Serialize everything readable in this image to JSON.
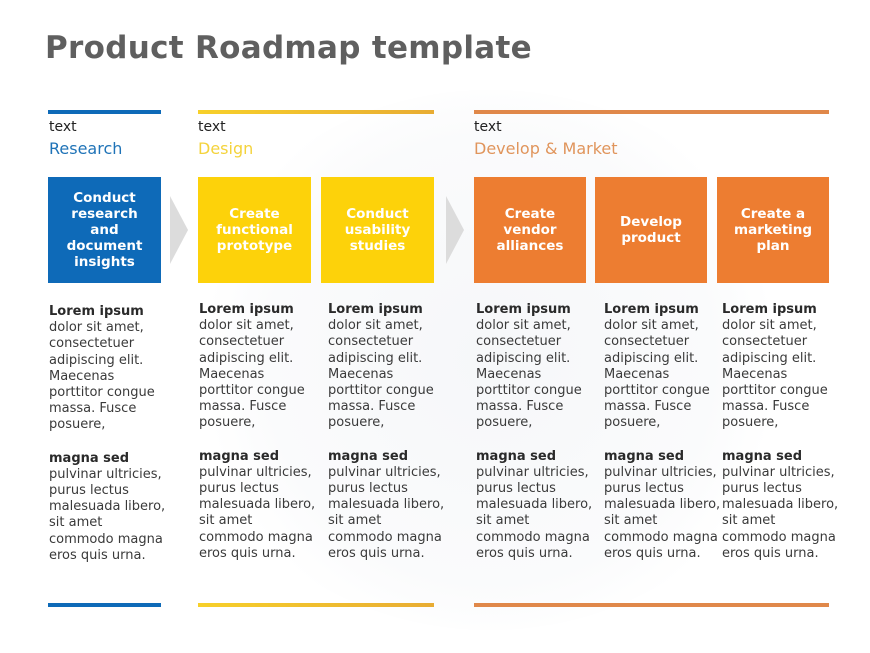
{
  "title": "Product Roadmap template",
  "colors": {
    "research": "#0e6ab8",
    "design": "#fdd20a",
    "develop": "#ed7d31",
    "arrow": "#dcdcdc"
  },
  "phases": [
    {
      "sub": "text",
      "name": "Research"
    },
    {
      "sub": "text",
      "name": "Design"
    },
    {
      "sub": "text",
      "name": "Develop & Market"
    }
  ],
  "boxes": [
    {
      "label": "Conduct research and document insights"
    },
    {
      "label": "Create functional prototype"
    },
    {
      "label": "Conduct usability studies"
    },
    {
      "label": "Create vendor alliances"
    },
    {
      "label": "Develop product"
    },
    {
      "label": "Create a marketing plan"
    }
  ],
  "columns": [
    {
      "h1": "Lorem ipsum",
      "p1": "dolor sit amet, consectetuer adipiscing elit. Maecenas porttitor congue massa. Fusce posuere,",
      "h2": "magna sed",
      "p2": "pulvinar ultricies, purus lectus malesuada libero, sit amet commodo magna eros quis urna."
    },
    {
      "h1": "Lorem ipsum",
      "p1": "dolor sit amet, consectetuer adipiscing elit. Maecenas porttitor congue massa. Fusce posuere,",
      "h2": "magna sed",
      "p2": "pulvinar ultricies, purus lectus malesuada libero, sit amet commodo magna eros quis urna."
    },
    {
      "h1": "Lorem ipsum",
      "p1": "dolor sit amet, consectetuer adipiscing elit. Maecenas porttitor congue massa. Fusce posuere,",
      "h2": "magna sed",
      "p2": "pulvinar ultricies, purus lectus malesuada libero, sit amet commodo magna eros quis urna."
    },
    {
      "h1": "Lorem ipsum",
      "p1": "dolor sit amet, consectetuer adipiscing elit. Maecenas porttitor congue massa. Fusce posuere,",
      "h2": "magna sed",
      "p2": "pulvinar ultricies, purus lectus malesuada libero, sit amet commodo magna eros quis urna."
    },
    {
      "h1": "Lorem ipsum",
      "p1": "dolor sit amet, consectetuer adipiscing elit. Maecenas porttitor congue massa. Fusce posuere,",
      "h2": "magna sed",
      "p2": "pulvinar ultricies, purus lectus malesuada libero, sit amet commodo magna eros quis urna."
    },
    {
      "h1": "Lorem ipsum",
      "p1": "dolor sit amet, consectetuer adipiscing elit. Maecenas porttitor congue massa. Fusce posuere,",
      "h2": "magna sed",
      "p2": "pulvinar ultricies, purus lectus malesuada libero, sit amet commodo magna eros quis urna."
    }
  ]
}
